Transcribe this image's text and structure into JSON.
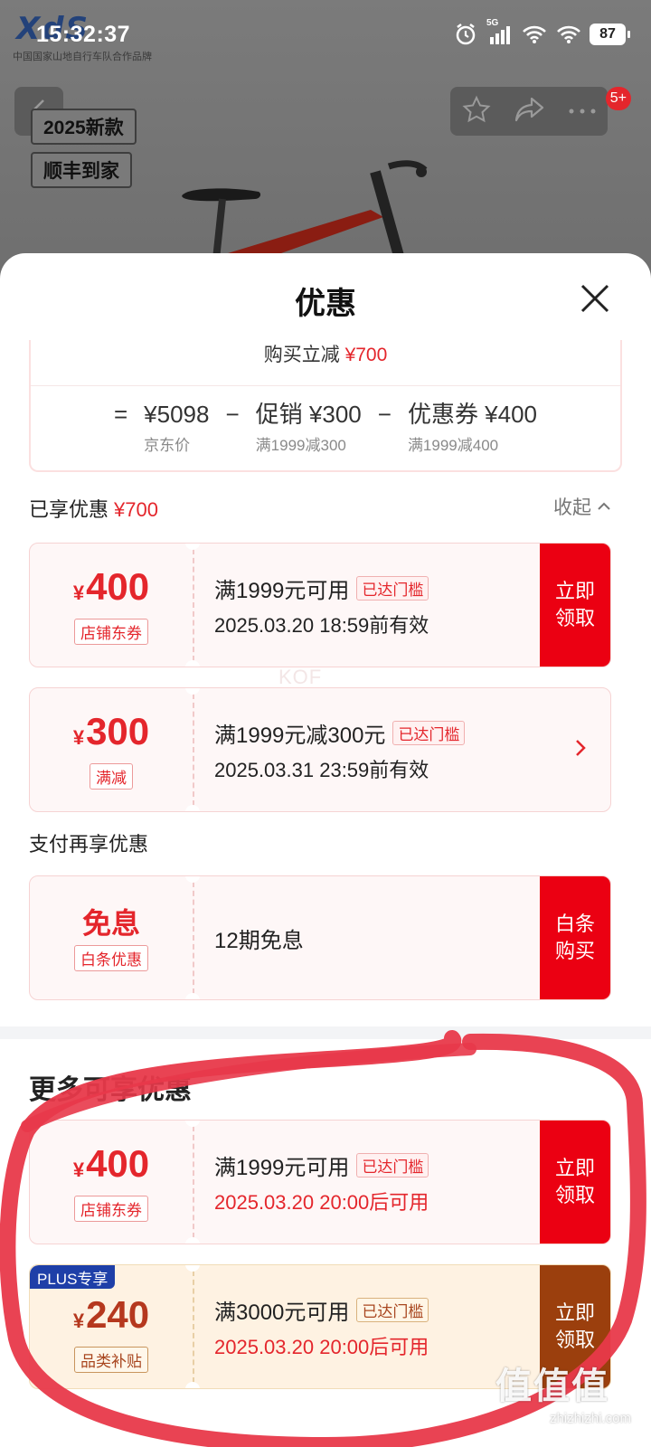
{
  "status_bar": {
    "time": "15:32:37",
    "network": "5G",
    "battery": "87"
  },
  "brand": {
    "logo_text": "XdS",
    "tagline": "中国国家山地自行车队合作品牌"
  },
  "product": {
    "tags": [
      "2025新款",
      "顺丰到家"
    ],
    "notification_badge": "5+"
  },
  "sheet": {
    "title": "优惠",
    "summary": {
      "headline_label": "购买立减",
      "headline_amount": "¥700",
      "equals": "=",
      "minus": "−",
      "items": [
        {
          "main": "¥5098",
          "sub": "京东价"
        },
        {
          "main": "促销 ¥300",
          "sub": "满1999减300"
        },
        {
          "main": "优惠券 ¥400",
          "sub": "满1999减400"
        }
      ]
    },
    "enjoyed": {
      "label": "已享优惠",
      "amount": "¥700",
      "collapse_label": "收起"
    },
    "pay_section_label": "支付再享优惠",
    "more_section_label": "更多可享优惠",
    "watermark": "KOF",
    "coupons": [
      {
        "currency": "¥",
        "amount": "400",
        "type_tag": "店铺东券",
        "condition": "满1999元可用",
        "threshold_badge": "已达门槛",
        "validity": "2025.03.20 18:59前有效",
        "cta": "立即领取"
      },
      {
        "currency": "¥",
        "amount": "300",
        "type_tag": "满减",
        "condition": "满1999元减300元",
        "threshold_badge": "已达门槛",
        "validity": "2025.03.31 23:59前有效"
      },
      {
        "big_text": "免息",
        "type_tag": "白条优惠",
        "condition": "12期免息",
        "cta": "白条购买"
      },
      {
        "currency": "¥",
        "amount": "400",
        "type_tag": "店铺东券",
        "condition": "满1999元可用",
        "threshold_badge": "已达门槛",
        "validity": "2025.03.20 20:00后可用",
        "cta": "立即领取"
      },
      {
        "plus_badge": "PLUS专享",
        "currency": "¥",
        "amount": "240",
        "type_tag": "品类补贴",
        "condition": "满3000元可用",
        "threshold_badge": "已达门槛",
        "validity": "2025.03.20 20:00后可用",
        "cta": "立即领取"
      }
    ]
  },
  "site_watermark": {
    "glyphs": "值值值",
    "url": "zhizhizhi.com"
  },
  "colors": {
    "accent_red": "#eb0012",
    "price_red": "#e4262c",
    "plus_cta_brown": "#9b3f0d",
    "plus_badge_blue": "#1e3fa8",
    "annotation_stroke": "#e8394a"
  }
}
